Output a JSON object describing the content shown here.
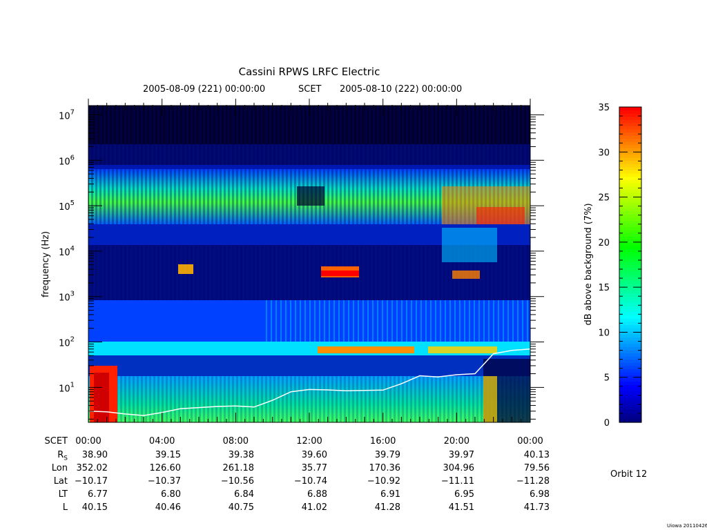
{
  "chart_data": {
    "type": "heatmap",
    "title": "Cassini RPWS LRFC Electric",
    "subtitle": {
      "start": "2005-08-09 (221) 00:00:00",
      "label": "SCET",
      "end": "2005-08-10 (222) 00:00:00"
    },
    "ylabel": "frequency (Hz)",
    "y_scale": "log",
    "ylim": [
      1.7,
      16000000
    ],
    "y_ticks": [
      {
        "value": 10,
        "base": "10",
        "exp": "1"
      },
      {
        "value": 100,
        "base": "10",
        "exp": "2"
      },
      {
        "value": 1000,
        "base": "10",
        "exp": "3"
      },
      {
        "value": 10000,
        "base": "10",
        "exp": "4"
      },
      {
        "value": 100000,
        "base": "10",
        "exp": "5"
      },
      {
        "value": 1000000,
        "base": "10",
        "exp": "6"
      },
      {
        "value": 10000000,
        "base": "10",
        "exp": "7"
      }
    ],
    "x_hours_range": [
      0,
      24
    ],
    "colorbar": {
      "label": "dB above background (7%)",
      "range": [
        0,
        35
      ],
      "ticks": [
        "0",
        "5",
        "10",
        "15",
        "20",
        "25",
        "30",
        "35"
      ],
      "colors": [
        "#000080",
        "#0000ff",
        "#0080ff",
        "#00ffff",
        "#00ff80",
        "#00ff00",
        "#80ff00",
        "#ffff00",
        "#ff8000",
        "#ff0000"
      ]
    },
    "ephemeris": {
      "row_labels": [
        "SCET",
        "R",
        "Lon",
        "Lat",
        "LT",
        "L"
      ],
      "rs_subscript": "S",
      "columns": [
        {
          "scet": "00:00",
          "rs": "38.90",
          "lon": "352.02",
          "lat": "−10.17",
          "lt": "6.77",
          "l": "40.15"
        },
        {
          "scet": "04:00",
          "rs": "39.15",
          "lon": "126.60",
          "lat": "−10.37",
          "lt": "6.80",
          "l": "40.46"
        },
        {
          "scet": "08:00",
          "rs": "39.38",
          "lon": "261.18",
          "lat": "−10.56",
          "lt": "6.84",
          "l": "40.75"
        },
        {
          "scet": "12:00",
          "rs": "39.60",
          "lon": "35.77",
          "lat": "−10.74",
          "lt": "6.88",
          "l": "41.02"
        },
        {
          "scet": "16:00",
          "rs": "39.79",
          "lon": "170.36",
          "lat": "−10.92",
          "lt": "6.91",
          "l": "41.28"
        },
        {
          "scet": "20:00",
          "rs": "39.97",
          "lon": "304.96",
          "lat": "−11.11",
          "lt": "6.95",
          "l": "41.51"
        },
        {
          "scet": "00:00",
          "rs": "40.13",
          "lon": "79.56",
          "lat": "−11.28",
          "lt": "6.98",
          "l": "41.73"
        }
      ]
    },
    "electron_cyclotron_line": {
      "hours": [
        0,
        1,
        2,
        3,
        4,
        5,
        6,
        7,
        8,
        9,
        10,
        11,
        12,
        13,
        14,
        15,
        16,
        17,
        18,
        19,
        20,
        21,
        22,
        23,
        24
      ],
      "freq_hz": [
        3.0,
        2.9,
        2.6,
        2.4,
        2.8,
        3.4,
        3.6,
        3.8,
        3.9,
        3.7,
        5.2,
        8.0,
        9.0,
        8.8,
        8.4,
        8.6,
        8.7,
        12.0,
        18.0,
        17.0,
        19.0,
        20.0,
        55.0,
        65.0,
        70.0
      ]
    }
  },
  "annotations": {
    "orbit": "Orbit 12",
    "stamp": "Uiowa 20110426"
  }
}
